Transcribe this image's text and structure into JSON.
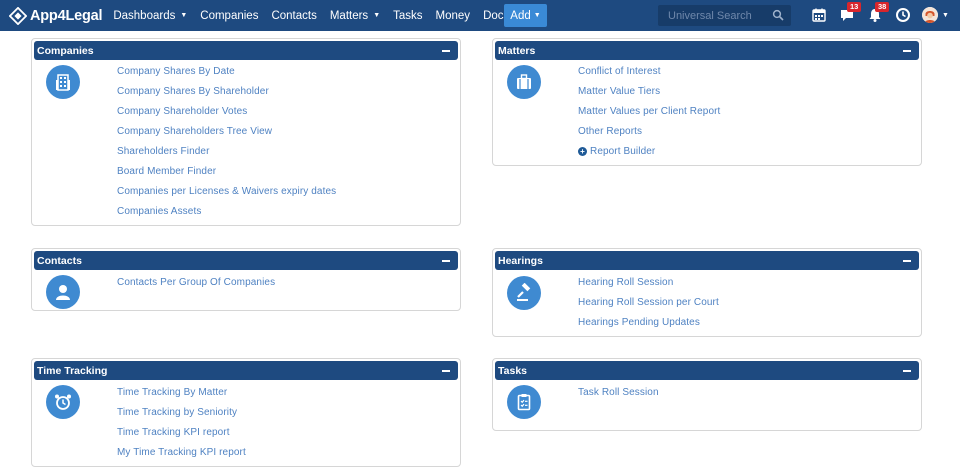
{
  "brand": {
    "name": "App4Legal",
    "logo_icon": "diamond-logo-icon"
  },
  "nav": {
    "items": [
      {
        "label": "Dashboards",
        "has_caret": true
      },
      {
        "label": "Companies",
        "has_caret": false
      },
      {
        "label": "Contacts",
        "has_caret": false
      },
      {
        "label": "Matters",
        "has_caret": true
      },
      {
        "label": "Tasks",
        "has_caret": false
      },
      {
        "label": "Money",
        "has_caret": false
      },
      {
        "label": "Docs",
        "has_caret": false
      }
    ],
    "more_label": "»",
    "add_label": "Add",
    "search_placeholder": "Universal Search",
    "messages_count": "13",
    "notifications_count": "38"
  },
  "colors": {
    "navbar": "#1e4a80",
    "panel_header": "#1e4a80",
    "icon_circle": "#3f8ad1",
    "link": "#4f82c2",
    "badge": "#d9262c",
    "add_button": "#3a8ad6"
  },
  "panels": {
    "companies": {
      "title": "Companies",
      "icon": "building-icon",
      "links": [
        "Company Shares By Date",
        "Company Shares By Shareholder",
        "Company Shareholder Votes",
        "Company Shareholders Tree View",
        "Shareholders Finder",
        "Board Member Finder",
        "Companies per Licenses & Waivers expiry dates",
        "Companies Assets"
      ]
    },
    "matters": {
      "title": "Matters",
      "icon": "briefcase-icon",
      "links": [
        "Conflict of Interest",
        "Matter Value Tiers",
        "Matter Values per Client Report",
        "Other Reports"
      ],
      "builder_label": "Report Builder"
    },
    "contacts": {
      "title": "Contacts",
      "icon": "person-icon",
      "links": [
        "Contacts Per Group Of Companies"
      ]
    },
    "hearings": {
      "title": "Hearings",
      "icon": "gavel-icon",
      "links": [
        "Hearing Roll Session",
        "Hearing Roll Session per Court",
        "Hearings Pending Updates"
      ]
    },
    "time_tracking": {
      "title": "Time Tracking",
      "icon": "alarm-clock-icon",
      "links": [
        "Time Tracking By Matter",
        "Time Tracking by Seniority",
        "Time Tracking KPI report",
        "My Time Tracking KPI report"
      ]
    },
    "tasks": {
      "title": "Tasks",
      "icon": "clipboard-icon",
      "links": [
        "Task Roll Session"
      ]
    }
  }
}
